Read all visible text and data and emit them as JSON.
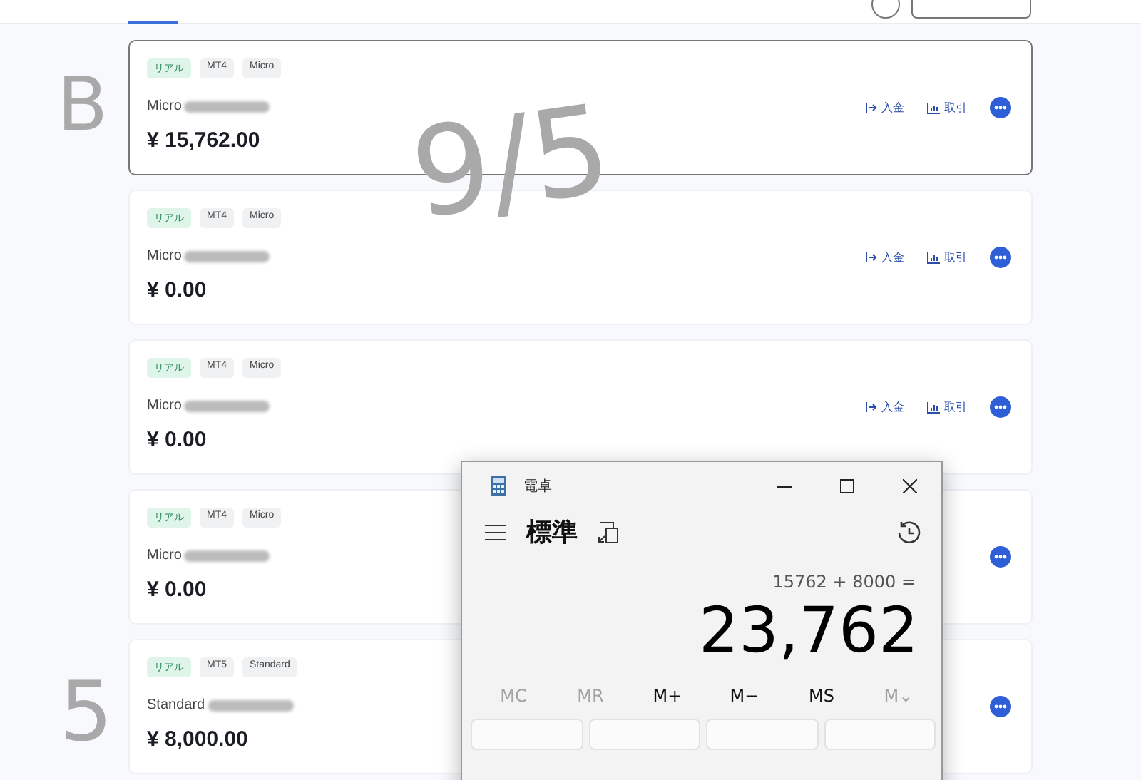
{
  "accounts": [
    {
      "tags": [
        {
          "label": "リアル",
          "kind": "real"
        },
        {
          "label": "MT4",
          "kind": "plain"
        },
        {
          "label": "Micro",
          "kind": "plain"
        }
      ],
      "name": "Micro",
      "balance": "¥ 15,762.00",
      "selected": true,
      "actions": [
        {
          "label": "入金",
          "kind": "deposit"
        },
        {
          "label": "取引",
          "kind": "trade"
        }
      ]
    },
    {
      "tags": [
        {
          "label": "リアル",
          "kind": "real"
        },
        {
          "label": "MT4",
          "kind": "plain"
        },
        {
          "label": "Micro",
          "kind": "plain"
        }
      ],
      "name": "Micro",
      "balance": "¥ 0.00",
      "selected": false,
      "actions": [
        {
          "label": "入金",
          "kind": "deposit"
        },
        {
          "label": "取引",
          "kind": "trade"
        }
      ]
    },
    {
      "tags": [
        {
          "label": "リアル",
          "kind": "real"
        },
        {
          "label": "MT4",
          "kind": "plain"
        },
        {
          "label": "Micro",
          "kind": "plain"
        }
      ],
      "name": "Micro",
      "balance": "¥ 0.00",
      "selected": false,
      "actions": [
        {
          "label": "入金",
          "kind": "deposit"
        },
        {
          "label": "取引",
          "kind": "trade"
        }
      ]
    },
    {
      "tags": [
        {
          "label": "リアル",
          "kind": "real"
        },
        {
          "label": "MT4",
          "kind": "plain"
        },
        {
          "label": "Micro",
          "kind": "plain"
        }
      ],
      "name": "Micro",
      "balance": "¥ 0.00",
      "selected": false
    },
    {
      "tags": [
        {
          "label": "リアル",
          "kind": "real"
        },
        {
          "label": "MT5",
          "kind": "plain"
        },
        {
          "label": "Standard",
          "kind": "plain"
        }
      ],
      "name": "Standard",
      "balance": "¥ 8,000.00",
      "selected": false
    }
  ],
  "annotations": [
    "B",
    "9/5",
    "5"
  ],
  "calculator": {
    "title": "電卓",
    "mode": "標準",
    "expression": "15762 + 8000 =",
    "result": "23,762",
    "memory": [
      {
        "label": "MC",
        "disabled": true
      },
      {
        "label": "MR",
        "disabled": true
      },
      {
        "label": "M+",
        "disabled": false
      },
      {
        "label": "M−",
        "disabled": false
      },
      {
        "label": "MS",
        "disabled": false
      },
      {
        "label": "M⌄",
        "disabled": true
      }
    ]
  }
}
